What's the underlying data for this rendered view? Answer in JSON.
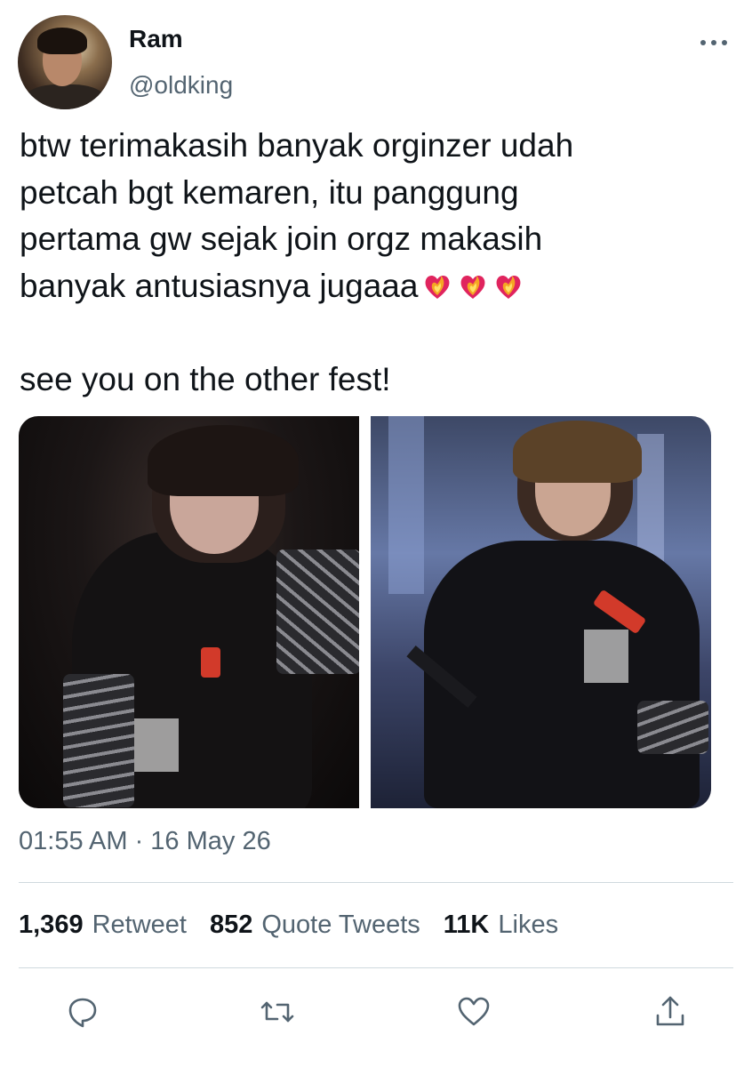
{
  "author": {
    "display_name": "Ram",
    "handle": "@oldking"
  },
  "tweet": {
    "text": "btw terimakasih banyak orginzer udah\npetcah bgt kemaren, itu panggung\npertama gw sejak join orgz makasih\nbanyak antusiasnya jugaaa",
    "emoji": [
      "heart-on-fire-icon",
      "heart-on-fire-icon",
      "heart-on-fire-icon"
    ],
    "text_second": "see you on the other fest!",
    "timestamp": "01:55 AM · 16 May 26"
  },
  "media": {
    "count": 2,
    "photos": [
      "photo-performer-black-shirt",
      "photo-performer-microphone"
    ]
  },
  "stats": {
    "retweets": "1,369",
    "retweets_label": "Retweet",
    "quotes": "852",
    "quotes_label": "Quote Tweets",
    "likes": "11K",
    "likes_label": "Likes"
  },
  "actions": [
    "reply-icon",
    "retweet-icon",
    "like-icon",
    "share-icon"
  ],
  "colors": {
    "text_primary": "#0f1419",
    "text_secondary": "#536471",
    "divider": "#cfd9de",
    "emoji_fire": "#f5a623",
    "emoji_heart": "#e0245e"
  }
}
